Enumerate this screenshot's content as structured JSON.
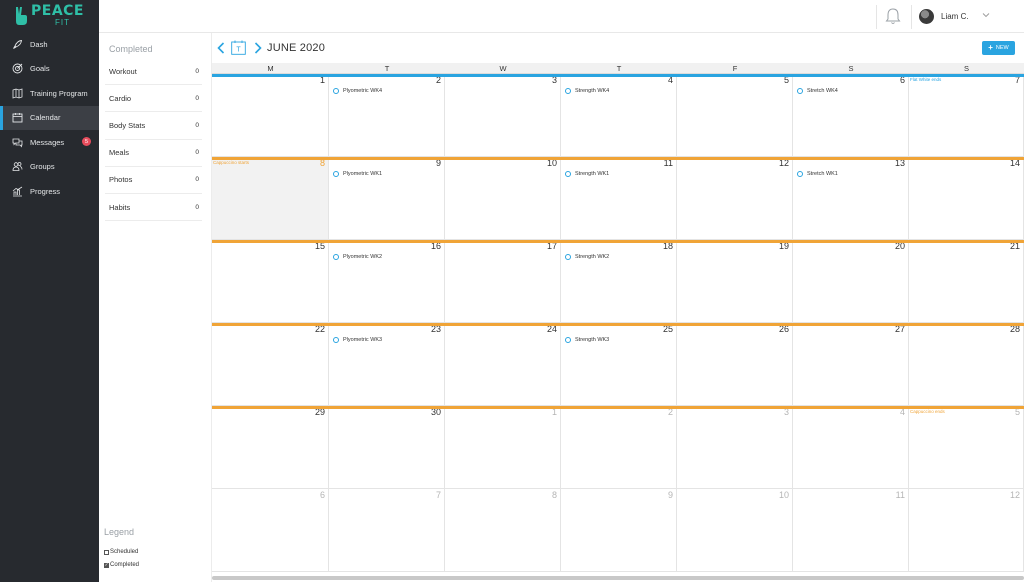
{
  "brand": {
    "name": "PEACE",
    "sub": "FIT",
    "color": "#2fbfa7"
  },
  "nav": [
    {
      "label": "Dash",
      "icon": "rocket-icon",
      "active": false,
      "badge": null
    },
    {
      "label": "Goals",
      "icon": "target-icon",
      "active": false,
      "badge": null
    },
    {
      "label": "Training Program",
      "icon": "map-icon",
      "active": false,
      "badge": null
    },
    {
      "label": "Calendar",
      "icon": "calendar-icon",
      "active": true,
      "badge": null
    },
    {
      "label": "Messages",
      "icon": "chat-icon",
      "active": false,
      "badge": "5"
    },
    {
      "label": "Groups",
      "icon": "users-icon",
      "active": false,
      "badge": null
    },
    {
      "label": "Progress",
      "icon": "chart-icon",
      "active": false,
      "badge": null
    }
  ],
  "user": {
    "name": "Liam C."
  },
  "completed": {
    "title": "Completed",
    "items": [
      {
        "label": "Workout",
        "value": "0"
      },
      {
        "label": "Cardio",
        "value": "0"
      },
      {
        "label": "Body Stats",
        "value": "0"
      },
      {
        "label": "Meals",
        "value": "0"
      },
      {
        "label": "Photos",
        "value": "0"
      },
      {
        "label": "Habits",
        "value": "0"
      }
    ]
  },
  "legend": {
    "title": "Legend",
    "scheduled": "Scheduled",
    "completed": "Completed"
  },
  "calendar": {
    "month_title": "JUNE 2020",
    "today_label": "T",
    "new_label": "NEW",
    "days_of_week": [
      "M",
      "T",
      "W",
      "T",
      "F",
      "S",
      "S"
    ],
    "colors": {
      "accent": "#2aa4e0",
      "orange": "#f0a437",
      "muted": "#b5b5b5"
    },
    "weeks": [
      {
        "bar": "blue",
        "days": [
          {
            "n": "1"
          },
          {
            "n": "2",
            "event": "Plyometric WK4"
          },
          {
            "n": "3"
          },
          {
            "n": "4",
            "event": "Strength WK4"
          },
          {
            "n": "5"
          },
          {
            "n": "6",
            "event": "Stretch WK4"
          },
          {
            "n": "7",
            "banner": "Flat White ends",
            "banner_color": "blue"
          }
        ]
      },
      {
        "bar": "orange",
        "days": [
          {
            "n": "8",
            "banner": "Cappuccino starts",
            "banner_color": "orange",
            "shaded": true,
            "orange": true
          },
          {
            "n": "9",
            "event": "Plyometric WK1"
          },
          {
            "n": "10"
          },
          {
            "n": "11",
            "event": "Strength WK1"
          },
          {
            "n": "12"
          },
          {
            "n": "13",
            "event": "Stretch WK1"
          },
          {
            "n": "14"
          }
        ]
      },
      {
        "bar": "orange",
        "days": [
          {
            "n": "15"
          },
          {
            "n": "16",
            "event": "Plyometric WK2"
          },
          {
            "n": "17"
          },
          {
            "n": "18",
            "event": "Strength WK2"
          },
          {
            "n": "19"
          },
          {
            "n": "20"
          },
          {
            "n": "21"
          }
        ]
      },
      {
        "bar": "orange",
        "days": [
          {
            "n": "22"
          },
          {
            "n": "23",
            "event": "Plyometric WK3"
          },
          {
            "n": "24"
          },
          {
            "n": "25",
            "event": "Strength WK3"
          },
          {
            "n": "26"
          },
          {
            "n": "27"
          },
          {
            "n": "28"
          }
        ]
      },
      {
        "bar": "orange",
        "days": [
          {
            "n": "29"
          },
          {
            "n": "30"
          },
          {
            "n": "1",
            "other": true
          },
          {
            "n": "2",
            "other": true
          },
          {
            "n": "3",
            "other": true
          },
          {
            "n": "4",
            "other": true
          },
          {
            "n": "5",
            "other": true,
            "banner": "Cappuccino ends",
            "banner_color": "orange"
          }
        ]
      },
      {
        "bar": "none",
        "days": [
          {
            "n": "6",
            "other": true
          },
          {
            "n": "7",
            "other": true
          },
          {
            "n": "8",
            "other": true
          },
          {
            "n": "9",
            "other": true
          },
          {
            "n": "10",
            "other": true
          },
          {
            "n": "11",
            "other": true
          },
          {
            "n": "12",
            "other": true
          }
        ]
      }
    ]
  }
}
